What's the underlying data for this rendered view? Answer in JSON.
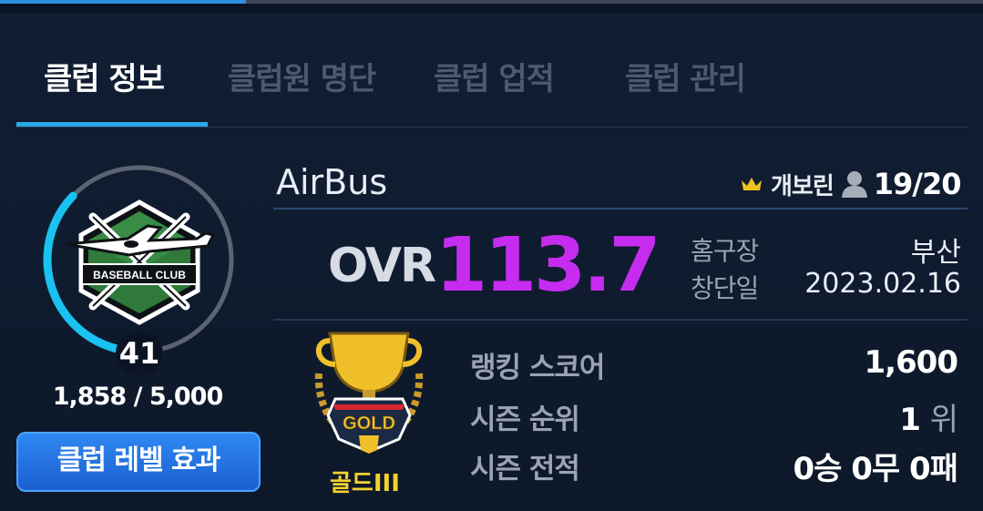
{
  "tabs": [
    {
      "label": "클럽 정보",
      "active": true
    },
    {
      "label": "클럽원 명단",
      "active": false
    },
    {
      "label": "클럽 업적",
      "active": false
    },
    {
      "label": "클럽 관리",
      "active": false
    }
  ],
  "club": {
    "name": "AirBus",
    "emblem_text": "BASEBALL CLUB",
    "level": "41",
    "exp": "1,858 / 5,000",
    "exp_progress": 0.3716,
    "level_button": "클럽 레벨 효과",
    "owner_icon": "crown-icon",
    "owner": "개보린",
    "member_icon": "person-icon",
    "members": "19/20"
  },
  "overall": {
    "label": "OVR",
    "value": "113.7"
  },
  "details": [
    {
      "label": "홈구장",
      "value": "부산"
    },
    {
      "label": "창단일",
      "value": "2023.02.16"
    }
  ],
  "tier": {
    "icon": "gold-trophy-icon",
    "badge": "GOLD",
    "label": "골드III"
  },
  "stats": {
    "ranking_score": {
      "label": "랭킹 스코어",
      "value": "1,600"
    },
    "season_rank": {
      "label": "시즌 순위",
      "value": "1",
      "unit": "위"
    },
    "season_record": {
      "label": "시즌 전적",
      "value": "0승 0무 0패"
    }
  },
  "colors": {
    "accent": "#2aa9e8",
    "ovr": "#c62cf0",
    "gold": "#f2d22d",
    "button": "#2070e0"
  }
}
